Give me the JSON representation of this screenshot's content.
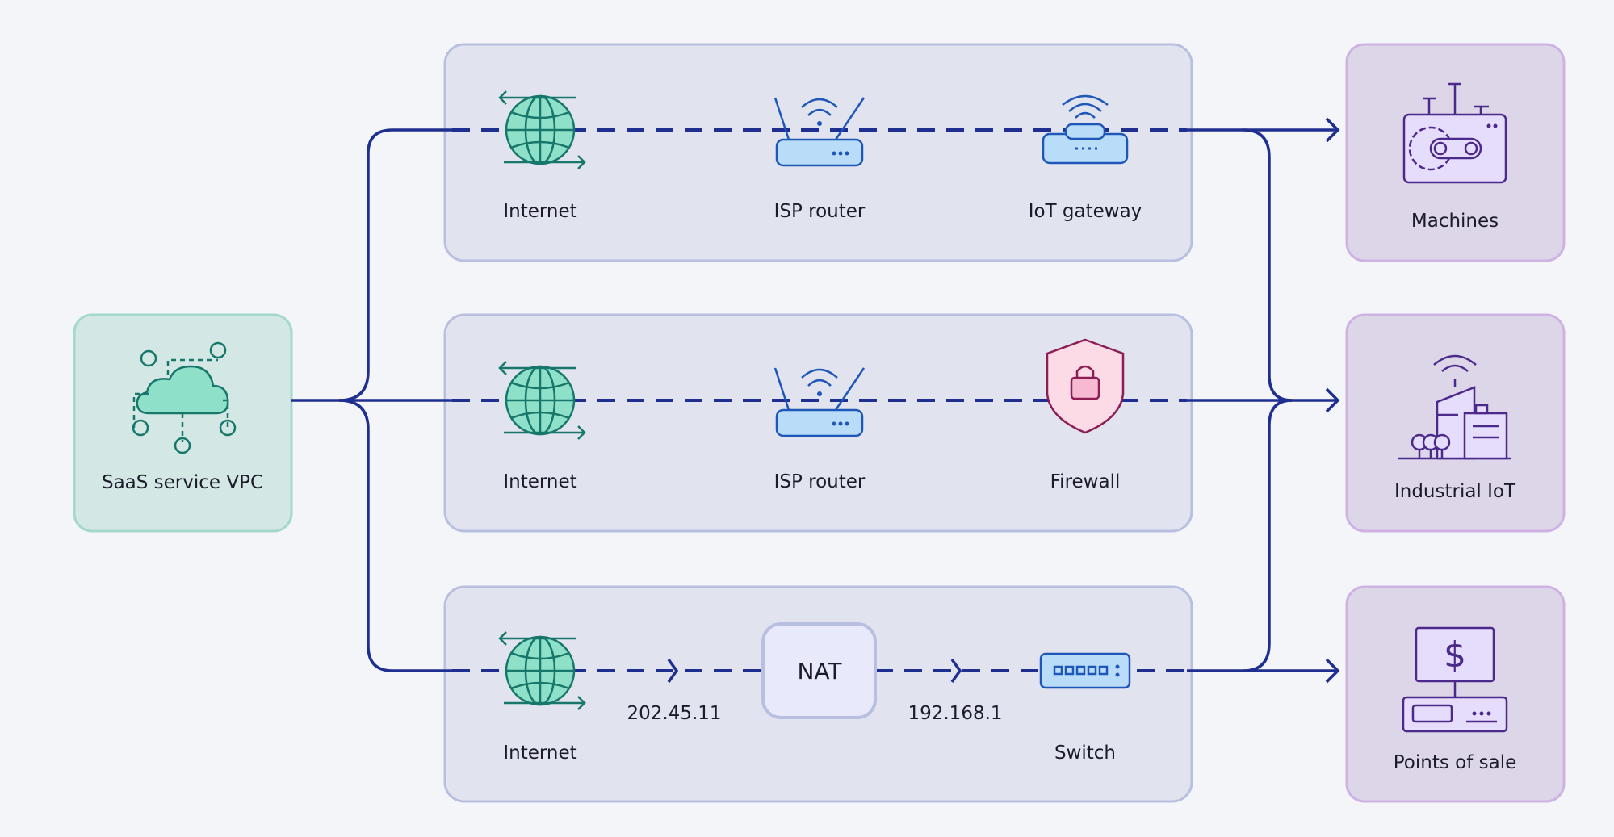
{
  "colors": {
    "background": "#f3f5f9",
    "connector": "#1f2f8f",
    "group_fill": "#e1e3ee",
    "group_border": "#b9bfe0",
    "source_fill": "#d3e8e5",
    "source_border": "#a5d8cc",
    "target_fill": "#ddd6e8",
    "target_border": "#cfb2e4"
  },
  "source": {
    "label": "SaaS service VPC",
    "icon": "cloud-network-icon"
  },
  "paths": [
    {
      "nodes": [
        {
          "label": "Internet",
          "icon": "globe-icon"
        },
        {
          "label": "ISP router",
          "icon": "router-icon"
        },
        {
          "label": "IoT gateway",
          "icon": "iot-gateway-icon"
        }
      ]
    },
    {
      "nodes": [
        {
          "label": "Internet",
          "icon": "globe-icon"
        },
        {
          "label": "ISP router",
          "icon": "router-icon"
        },
        {
          "label": "Firewall",
          "icon": "shield-lock-icon"
        }
      ]
    },
    {
      "nodes": [
        {
          "label": "Internet",
          "icon": "globe-icon"
        },
        {
          "label": "NAT",
          "icon": "nat-box"
        },
        {
          "label": "Switch",
          "icon": "switch-icon"
        }
      ],
      "ip_labels": [
        "202.45.11",
        "192.168.1"
      ]
    }
  ],
  "targets": [
    {
      "label": "Machines",
      "icon": "machine-gear-icon"
    },
    {
      "label": "Industrial IoT",
      "icon": "factory-icon"
    },
    {
      "label": "Points of sale",
      "icon": "pos-terminal-icon"
    }
  ]
}
